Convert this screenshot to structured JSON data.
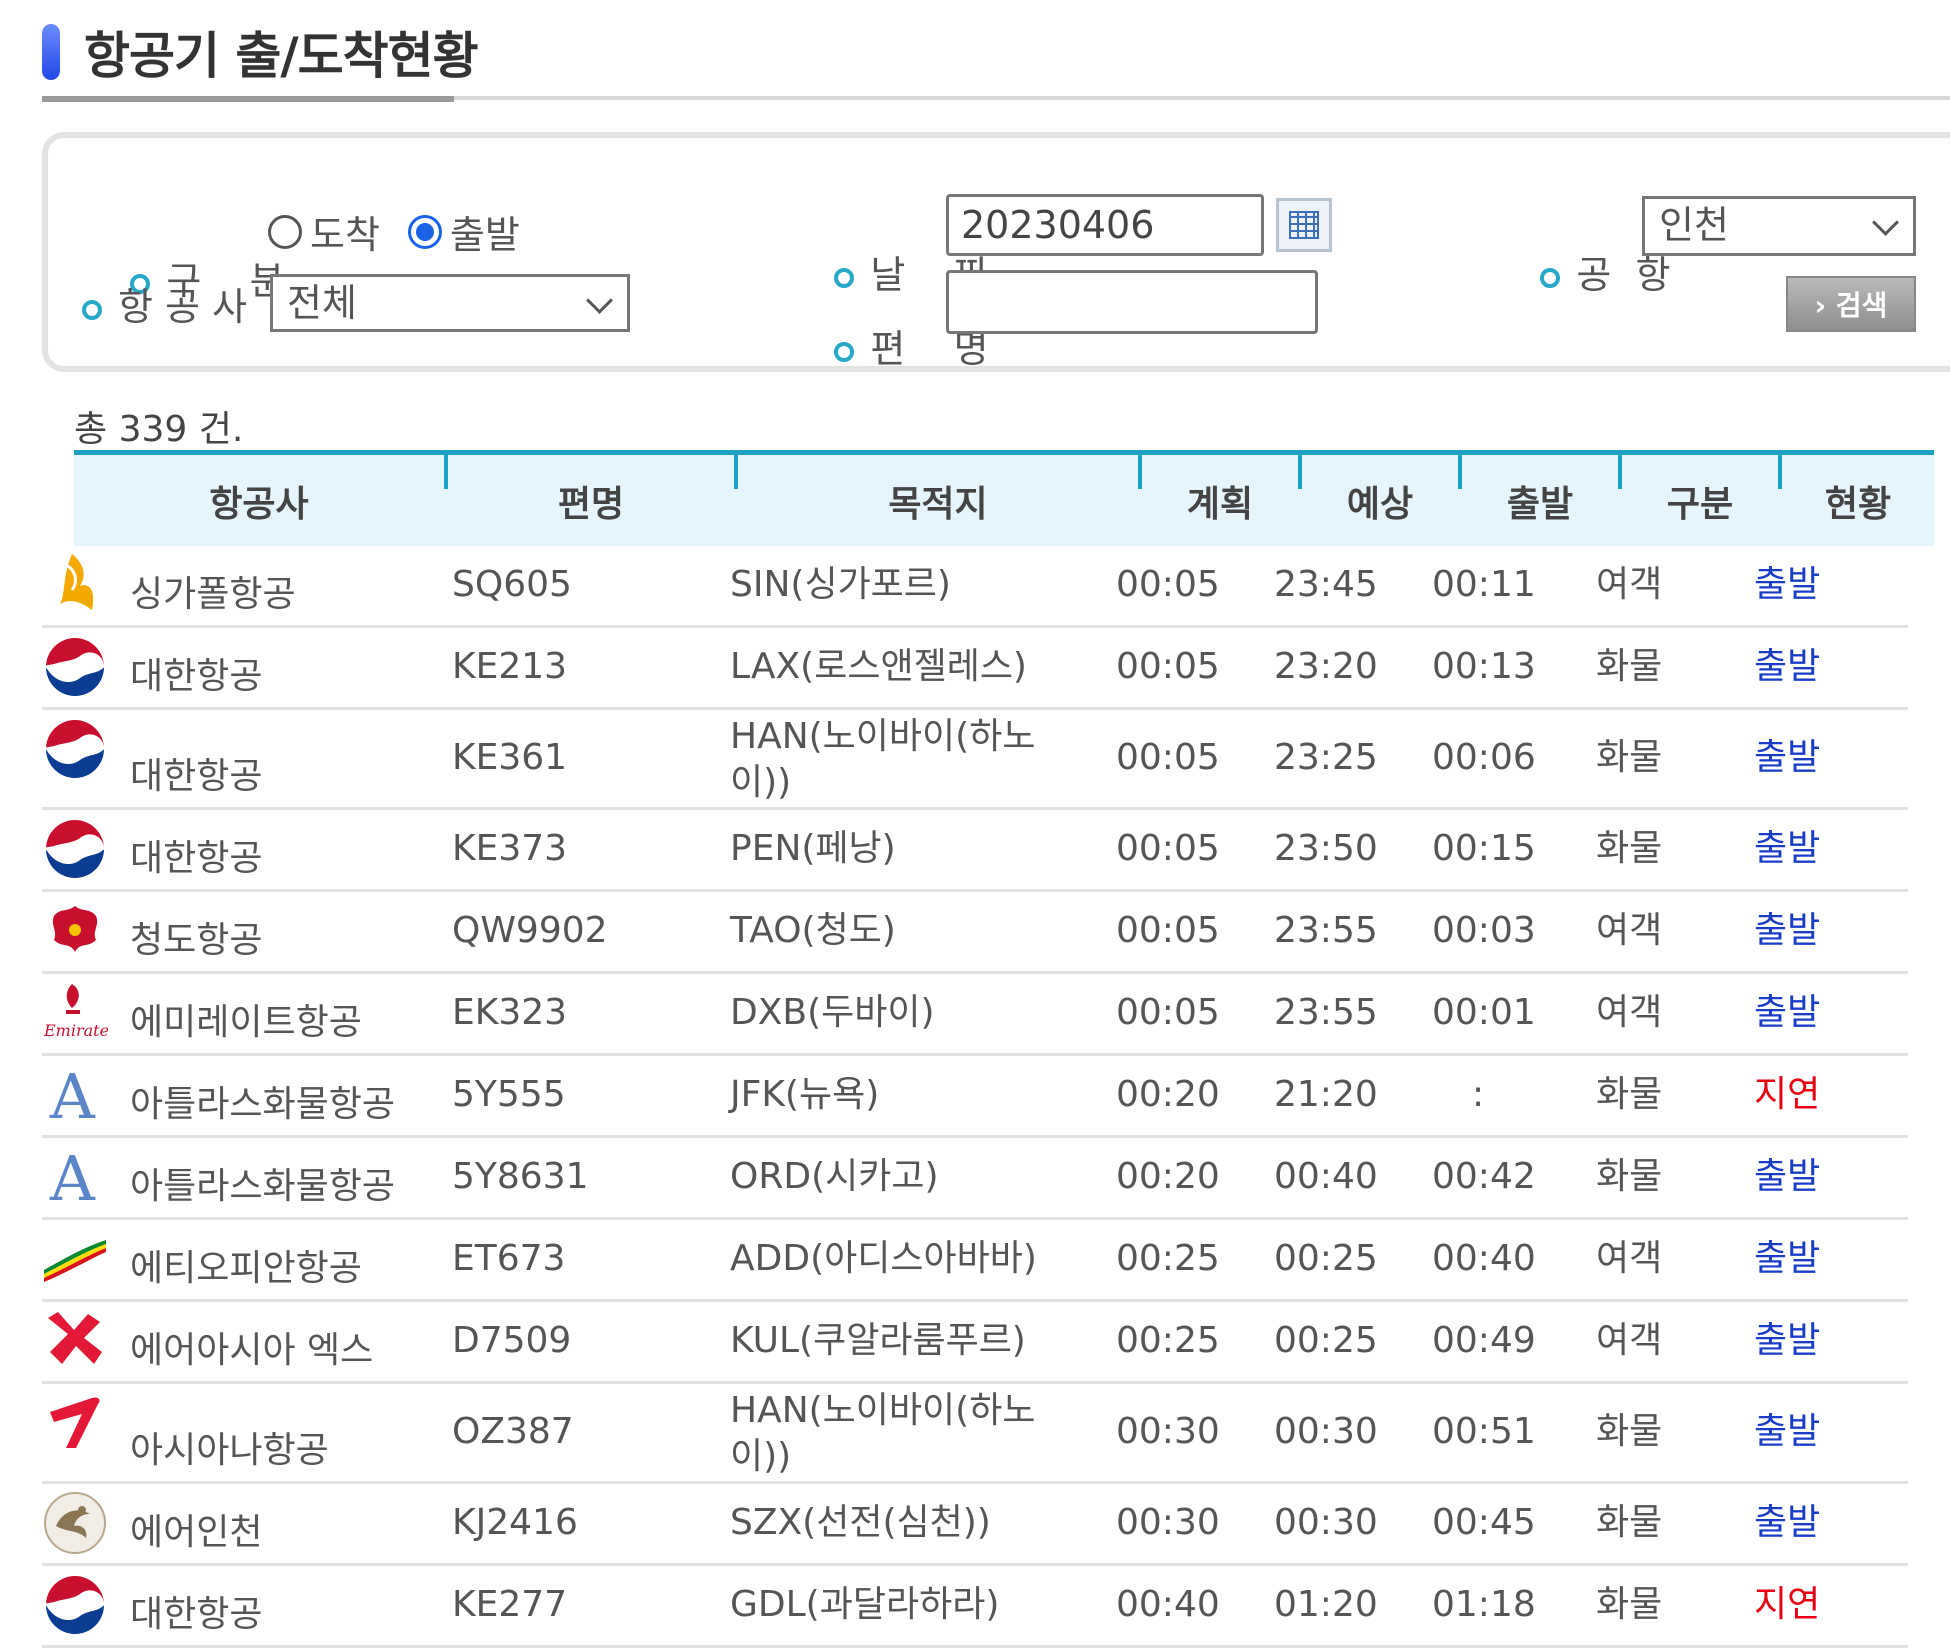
{
  "page": {
    "title": "항공기 출/도착현황"
  },
  "search": {
    "type_label": "구    분",
    "radio_arrival": "도착",
    "radio_departure": "출발",
    "selected": "출발",
    "airline_label": "항 공 사",
    "airline_value": "전체",
    "date_label": "날    짜",
    "date_value": "20230406",
    "flight_label": "편    명",
    "flight_value": "",
    "airport_label": "공  항",
    "airport_value": "인천",
    "search_button": "› 검색"
  },
  "total": "총 339 건.",
  "table": {
    "headers": [
      "항공사",
      "편명",
      "목적지",
      "계획",
      "예상",
      "출발",
      "구분",
      "현황"
    ],
    "rows": [
      {
        "airline": "싱가폴항공",
        "logo": "singapore-airlines-logo",
        "flight": "SQ605",
        "dest": "SIN(싱가포르)",
        "plan": "00:05",
        "expected": "23:45",
        "actual": "00:11",
        "type": "여객",
        "status": "출발"
      },
      {
        "airline": "대한항공",
        "logo": "korean-air-logo",
        "flight": "KE213",
        "dest": "LAX(로스앤젤레스)",
        "plan": "00:05",
        "expected": "23:20",
        "actual": "00:13",
        "type": "화물",
        "status": "출발"
      },
      {
        "airline": "대한항공",
        "logo": "korean-air-logo",
        "flight": "KE361",
        "dest": "HAN(노이바이(하노이))",
        "plan": "00:05",
        "expected": "23:25",
        "actual": "00:06",
        "type": "화물",
        "status": "출발"
      },
      {
        "airline": "대한항공",
        "logo": "korean-air-logo",
        "flight": "KE373",
        "dest": "PEN(페낭)",
        "plan": "00:05",
        "expected": "23:50",
        "actual": "00:15",
        "type": "화물",
        "status": "출발"
      },
      {
        "airline": "청도항공",
        "logo": "qingdao-airlines-logo",
        "flight": "QW9902",
        "dest": "TAO(청도)",
        "plan": "00:05",
        "expected": "23:55",
        "actual": "00:03",
        "type": "여객",
        "status": "출발"
      },
      {
        "airline": "에미레이트항공",
        "logo": "emirates-logo",
        "flight": "EK323",
        "dest": "DXB(두바이)",
        "plan": "00:05",
        "expected": "23:55",
        "actual": "00:01",
        "type": "여객",
        "status": "출발"
      },
      {
        "airline": "아틀라스화물항공",
        "logo": "atlas-air-logo",
        "flight": "5Y555",
        "dest": "JFK(뉴욕)",
        "plan": "00:20",
        "expected": "21:20",
        "actual": ":",
        "type": "화물",
        "status": "지연"
      },
      {
        "airline": "아틀라스화물항공",
        "logo": "atlas-air-logo",
        "flight": "5Y8631",
        "dest": "ORD(시카고)",
        "plan": "00:20",
        "expected": "00:40",
        "actual": "00:42",
        "type": "화물",
        "status": "출발"
      },
      {
        "airline": "에티오피안항공",
        "logo": "ethiopian-airlines-logo",
        "flight": "ET673",
        "dest": "ADD(아디스아바바)",
        "plan": "00:25",
        "expected": "00:25",
        "actual": "00:40",
        "type": "여객",
        "status": "출발"
      },
      {
        "airline": "에어아시아 엑스",
        "logo": "airasia-x-logo",
        "flight": "D7509",
        "dest": "KUL(쿠알라룸푸르)",
        "plan": "00:25",
        "expected": "00:25",
        "actual": "00:49",
        "type": "여객",
        "status": "출발"
      },
      {
        "airline": "아시아나항공",
        "logo": "asiana-logo",
        "flight": "OZ387",
        "dest": "HAN(노이바이(하노이))",
        "plan": "00:30",
        "expected": "00:30",
        "actual": "00:51",
        "type": "화물",
        "status": "출발"
      },
      {
        "airline": "에어인천",
        "logo": "air-incheon-logo",
        "flight": "KJ2416",
        "dest": "SZX(선전(심천))",
        "plan": "00:30",
        "expected": "00:30",
        "actual": "00:45",
        "type": "화물",
        "status": "출발"
      },
      {
        "airline": "대한항공",
        "logo": "korean-air-logo",
        "flight": "KE277",
        "dest": "GDL(과달라하라)",
        "plan": "00:40",
        "expected": "01:20",
        "actual": "01:18",
        "type": "화물",
        "status": "지연"
      }
    ]
  }
}
